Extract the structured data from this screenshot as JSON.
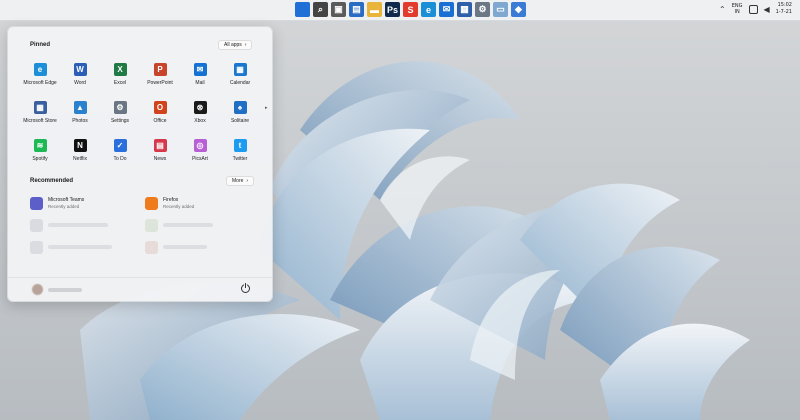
{
  "taskbar": {
    "icons": [
      {
        "name": "start-icon",
        "glyph": "",
        "bg": "#1f6fd6"
      },
      {
        "name": "search-icon",
        "glyph": "⌕",
        "bg": "#444444"
      },
      {
        "name": "task-view-icon",
        "glyph": "▣",
        "bg": "#5a5a5a"
      },
      {
        "name": "widgets-icon",
        "glyph": "▤",
        "bg": "#2a6cc4"
      },
      {
        "name": "file-explorer-icon",
        "glyph": "▬",
        "bg": "#e8b43a"
      },
      {
        "name": "photoshop-icon",
        "glyph": "Ps",
        "bg": "#0f2a4a"
      },
      {
        "name": "slides-icon",
        "glyph": "S",
        "bg": "#e23b2e"
      },
      {
        "name": "edge-icon",
        "glyph": "e",
        "bg": "#1b8fd6"
      },
      {
        "name": "mail-icon",
        "glyph": "✉",
        "bg": "#1a6fd2"
      },
      {
        "name": "store-icon",
        "glyph": "▦",
        "bg": "#2f5fa8"
      },
      {
        "name": "settings-icon",
        "glyph": "⚙",
        "bg": "#6b7785"
      },
      {
        "name": "monitor-icon",
        "glyph": "▭",
        "bg": "#7fa8d1"
      },
      {
        "name": "app-icon",
        "glyph": "◆",
        "bg": "#3a7bd5"
      }
    ],
    "tray": {
      "language_line1": "ENG",
      "language_line2": "IN",
      "time": "15:02",
      "date": "1-7-21"
    }
  },
  "start_menu": {
    "pinned_title": "Pinned",
    "all_apps_label": "All apps",
    "apps": [
      {
        "label": "Microsoft Edge",
        "icon": "edge-icon",
        "glyph": "e",
        "color": "#1d8fd8"
      },
      {
        "label": "Word",
        "icon": "word-icon",
        "glyph": "W",
        "color": "#2b5fb7"
      },
      {
        "label": "Excel",
        "icon": "excel-icon",
        "glyph": "X",
        "color": "#1f7a45"
      },
      {
        "label": "PowerPoint",
        "icon": "powerpoint-icon",
        "glyph": "P",
        "color": "#c7452a"
      },
      {
        "label": "Mail",
        "icon": "mail-icon",
        "glyph": "✉",
        "color": "#1473d2"
      },
      {
        "label": "Calendar",
        "icon": "calendar-icon",
        "glyph": "▦",
        "color": "#1a77cf"
      },
      {
        "label": "Microsoft Store",
        "icon": "store-icon",
        "glyph": "▦",
        "color": "#3a5f9e"
      },
      {
        "label": "Photos",
        "icon": "photos-icon",
        "glyph": "▲",
        "color": "#2a82cf"
      },
      {
        "label": "Settings",
        "icon": "settings-icon",
        "glyph": "⚙",
        "color": "#6a7683"
      },
      {
        "label": "Office",
        "icon": "office-icon",
        "glyph": "O",
        "color": "#d0431d"
      },
      {
        "label": "Xbox",
        "icon": "xbox-icon",
        "glyph": "⊗",
        "color": "#1a1a1a"
      },
      {
        "label": "Solitaire",
        "icon": "solitaire-icon",
        "glyph": "♠",
        "color": "#1f6fc4"
      },
      {
        "label": "Spotify",
        "icon": "spotify-icon",
        "glyph": "≋",
        "color": "#1cb954"
      },
      {
        "label": "Netflix",
        "icon": "netflix-icon",
        "glyph": "N",
        "color": "#111111"
      },
      {
        "label": "To Do",
        "icon": "todo-icon",
        "glyph": "✓",
        "color": "#2a6fdb"
      },
      {
        "label": "News",
        "icon": "news-icon",
        "glyph": "▤",
        "color": "#d6374a"
      },
      {
        "label": "PicsArt",
        "icon": "picsart-icon",
        "glyph": "◎",
        "color": "#b85fd6"
      },
      {
        "label": "Twitter",
        "icon": "twitter-icon",
        "glyph": "t",
        "color": "#1d9bf0"
      }
    ],
    "recommended_title": "Recommended",
    "more_label": "More",
    "recommended": [
      {
        "name": "Microsoft Teams",
        "sub": "Recently added",
        "icon": "teams-icon",
        "color": "#5b5fc7"
      },
      {
        "name": "Firefox",
        "sub": "Recently added",
        "icon": "firefox-icon",
        "color": "#f07b1c"
      }
    ]
  }
}
